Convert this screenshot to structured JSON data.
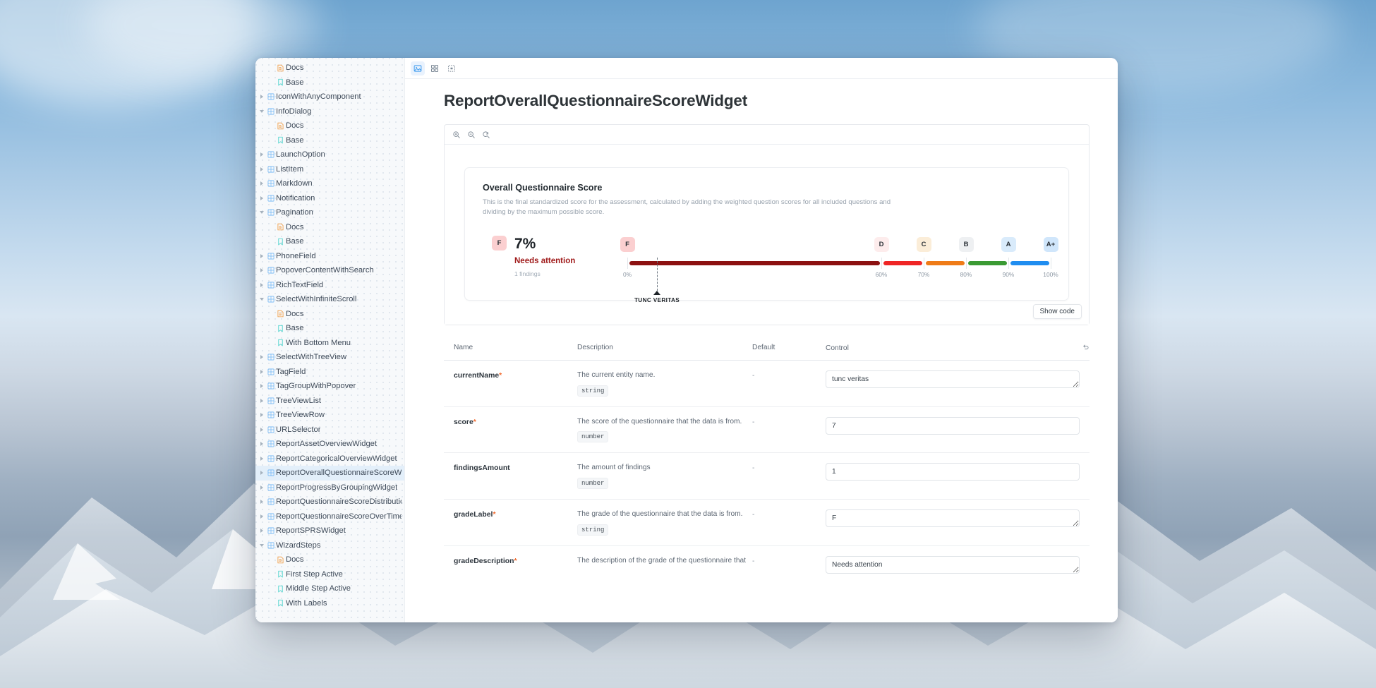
{
  "window": {
    "toolbar": {
      "buttons": [
        {
          "name": "canvas-view-icon",
          "label": "Canvas",
          "active": true
        },
        {
          "name": "grid-view-icon",
          "label": "Grid",
          "active": false
        },
        {
          "name": "fit-view-icon",
          "label": "Fit",
          "active": false
        }
      ]
    }
  },
  "sidebar": {
    "items": [
      {
        "label": "Docs",
        "level": 2,
        "icon": "docs-icon",
        "twisty": "none"
      },
      {
        "label": "Base",
        "level": 2,
        "icon": "story-icon",
        "twisty": "none"
      },
      {
        "label": "IconWithAnyComponent",
        "level": 1,
        "icon": "component-icon",
        "twisty": "right"
      },
      {
        "label": "InfoDialog",
        "level": 1,
        "icon": "component-icon",
        "twisty": "down"
      },
      {
        "label": "Docs",
        "level": 2,
        "icon": "docs-icon",
        "twisty": "none"
      },
      {
        "label": "Base",
        "level": 2,
        "icon": "story-icon",
        "twisty": "none"
      },
      {
        "label": "LaunchOption",
        "level": 1,
        "icon": "component-icon",
        "twisty": "right"
      },
      {
        "label": "ListItem",
        "level": 1,
        "icon": "component-icon",
        "twisty": "right"
      },
      {
        "label": "Markdown",
        "level": 1,
        "icon": "component-icon",
        "twisty": "right"
      },
      {
        "label": "Notification",
        "level": 1,
        "icon": "component-icon",
        "twisty": "right"
      },
      {
        "label": "Pagination",
        "level": 1,
        "icon": "component-icon",
        "twisty": "down"
      },
      {
        "label": "Docs",
        "level": 2,
        "icon": "docs-icon",
        "twisty": "none"
      },
      {
        "label": "Base",
        "level": 2,
        "icon": "story-icon",
        "twisty": "none"
      },
      {
        "label": "PhoneField",
        "level": 1,
        "icon": "component-icon",
        "twisty": "right"
      },
      {
        "label": "PopoverContentWithSearch",
        "level": 1,
        "icon": "component-icon",
        "twisty": "right"
      },
      {
        "label": "RichTextField",
        "level": 1,
        "icon": "component-icon",
        "twisty": "right"
      },
      {
        "label": "SelectWithInfiniteScroll",
        "level": 1,
        "icon": "component-icon",
        "twisty": "down"
      },
      {
        "label": "Docs",
        "level": 2,
        "icon": "docs-icon",
        "twisty": "none"
      },
      {
        "label": "Base",
        "level": 2,
        "icon": "story-icon",
        "twisty": "none"
      },
      {
        "label": "With Bottom Menu",
        "level": 2,
        "icon": "story-icon",
        "twisty": "none"
      },
      {
        "label": "SelectWithTreeView",
        "level": 1,
        "icon": "component-icon",
        "twisty": "right"
      },
      {
        "label": "TagField",
        "level": 1,
        "icon": "component-icon",
        "twisty": "right"
      },
      {
        "label": "TagGroupWithPopover",
        "level": 1,
        "icon": "component-icon",
        "twisty": "right"
      },
      {
        "label": "TreeViewList",
        "level": 1,
        "icon": "component-icon",
        "twisty": "right"
      },
      {
        "label": "TreeViewRow",
        "level": 1,
        "icon": "component-icon",
        "twisty": "right"
      },
      {
        "label": "URLSelector",
        "level": 1,
        "icon": "component-icon",
        "twisty": "right"
      },
      {
        "label": "ReportAssetOverviewWidget",
        "level": 1,
        "icon": "component-icon",
        "twisty": "right"
      },
      {
        "label": "ReportCategoricalOverviewWidget",
        "level": 1,
        "icon": "component-icon",
        "twisty": "right"
      },
      {
        "label": "ReportOverallQuestionnaireScoreWidget",
        "level": 1,
        "icon": "component-icon",
        "twisty": "right",
        "selected": true
      },
      {
        "label": "ReportProgressByGroupingWidget",
        "level": 1,
        "icon": "component-icon",
        "twisty": "right"
      },
      {
        "label": "ReportQuestionnaireScoreDistributionWidget",
        "level": 1,
        "icon": "component-icon",
        "twisty": "right"
      },
      {
        "label": "ReportQuestionnaireScoreOverTimeWidget",
        "level": 1,
        "icon": "component-icon",
        "twisty": "right"
      },
      {
        "label": "ReportSPRSWidget",
        "level": 1,
        "icon": "component-icon",
        "twisty": "right"
      },
      {
        "label": "WizardSteps",
        "level": 1,
        "icon": "component-icon",
        "twisty": "down"
      },
      {
        "label": "Docs",
        "level": 2,
        "icon": "docs-icon",
        "twisty": "none"
      },
      {
        "label": "First Step Active",
        "level": 2,
        "icon": "story-icon",
        "twisty": "none"
      },
      {
        "label": "Middle Step Active",
        "level": 2,
        "icon": "story-icon",
        "twisty": "none"
      },
      {
        "label": "With Labels",
        "level": 2,
        "icon": "story-icon",
        "twisty": "none"
      }
    ]
  },
  "page": {
    "title": "ReportOverallQuestionnaireScoreWidget"
  },
  "preview": {
    "zoom_buttons": [
      {
        "name": "zoom-in-icon",
        "label": "Zoom in"
      },
      {
        "name": "zoom-out-icon",
        "label": "Zoom out"
      },
      {
        "name": "zoom-reset-icon",
        "label": "Reset zoom"
      }
    ],
    "show_code_label": "Show code"
  },
  "widget": {
    "title": "Overall Questionnaire Score",
    "description": "This is the final standardized score for the assessment, calculated by adding the weighted question scores for all included questions and dividing by the maximum possible score.",
    "grade_label": "F",
    "score_value": "7%",
    "status_text": "Needs attention",
    "findings_text": "1 findings",
    "marker_label": "TUNC VERITAS",
    "status_color": "#a01b1b",
    "grade_chip_bg": "#fbcfd0"
  },
  "chart_data": {
    "type": "bar",
    "title": "Overall Questionnaire Score",
    "xlabel": "",
    "ylabel": "",
    "xlim": [
      0,
      100
    ],
    "grid": false,
    "legend": "none",
    "marker": {
      "label": "TUNC VERITAS",
      "value": 7,
      "unit": "%"
    },
    "tick_labels": [
      "0%",
      "60%",
      "70%",
      "80%",
      "90%",
      "100%"
    ],
    "tick_values": [
      0,
      60,
      70,
      80,
      90,
      100
    ],
    "categories": [
      "F",
      "D",
      "C",
      "B",
      "A",
      "A+"
    ],
    "segments": [
      {
        "grade": "F",
        "start": 0,
        "end": 60,
        "color": "#8c1111",
        "badge_bg": "#fbcfd0",
        "tick_label": "0%"
      },
      {
        "grade": "D",
        "start": 60,
        "end": 70,
        "color": "#ef2525",
        "badge_bg": "#fdecec",
        "tick_label": "60%"
      },
      {
        "grade": "C",
        "start": 70,
        "end": 80,
        "color": "#ef7b17",
        "badge_bg": "#fbedd8",
        "tick_label": "70%"
      },
      {
        "grade": "B",
        "start": 80,
        "end": 90,
        "color": "#3a9a33",
        "badge_bg": "#eef0f2",
        "tick_label": "80%"
      },
      {
        "grade": "A",
        "start": 90,
        "end": 100,
        "color": "#1f8df0",
        "badge_bg": "#d9ebfb",
        "tick_label": "90%"
      },
      {
        "grade": "A+",
        "start": 100,
        "end": 100,
        "color": "#1f8df0",
        "badge_bg": "#d0e6fb",
        "tick_label": "100%"
      }
    ]
  },
  "props": {
    "headers": {
      "name": "Name",
      "description": "Description",
      "default": "Default",
      "control": "Control"
    },
    "reset_icon": "reset-controls-icon",
    "rows": [
      {
        "name": "currentName",
        "required": true,
        "description": "The current entity name.",
        "type": "string",
        "default": "-",
        "control_kind": "textarea",
        "control_value": "tunc veritas"
      },
      {
        "name": "score",
        "required": true,
        "description": "The score of the questionnaire that the data is from.",
        "type": "number",
        "default": "-",
        "control_kind": "input",
        "control_value": "7"
      },
      {
        "name": "findingsAmount",
        "required": false,
        "description": "The amount of findings",
        "type": "number",
        "default": "-",
        "control_kind": "input",
        "control_value": "1"
      },
      {
        "name": "gradeLabel",
        "required": true,
        "description": "The grade of the questionnaire that the data is from.",
        "type": "string",
        "default": "-",
        "control_kind": "textarea",
        "control_value": "F"
      },
      {
        "name": "gradeDescription",
        "required": true,
        "description": "The description of the grade of the questionnaire that",
        "type": "",
        "default": "-",
        "control_kind": "textarea",
        "control_value": "Needs attention"
      }
    ]
  }
}
